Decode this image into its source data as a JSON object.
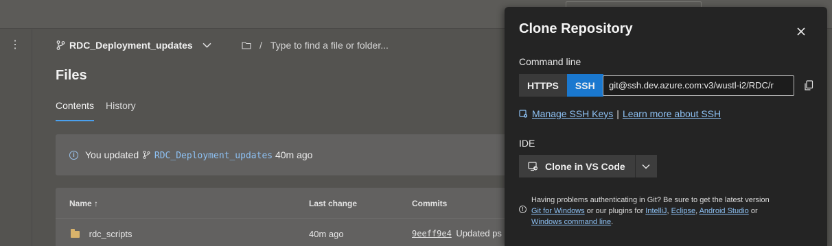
{
  "branch": {
    "name": "RDC_Deployment_updates"
  },
  "path": {
    "separator": "/",
    "placeholder": "Type to find a file or folder..."
  },
  "files_title": "Files",
  "tabs": [
    {
      "label": "Contents",
      "active": true
    },
    {
      "label": "History",
      "active": false
    }
  ],
  "banner": {
    "prefix": "You updated",
    "branch": "RDC_Deployment_updates",
    "suffix": "40m ago"
  },
  "table": {
    "headers": {
      "name": "Name ↑",
      "last_change": "Last change",
      "commits": "Commits"
    },
    "rows": [
      {
        "name": "rdc_scripts",
        "last_change": "40m ago",
        "commit_hash": "9eeff9e4",
        "commit_msg": "Updated ps"
      }
    ]
  },
  "clone_panel": {
    "title": "Clone Repository",
    "command_line_label": "Command line",
    "protocols": [
      {
        "label": "HTTPS",
        "active": false
      },
      {
        "label": "SSH",
        "active": true
      }
    ],
    "url": "git@ssh.dev.azure.com:v3/wustl-i2/RDC/r",
    "manage_keys": "Manage SSH Keys",
    "link_sep": "|",
    "learn_more": "Learn more about SSH",
    "ide_label": "IDE",
    "ide_button": "Clone in VS Code",
    "help": {
      "line1": "Having problems authenticating in Git? Be sure to get the latest version",
      "git_windows": "Git for Windows",
      "mid": " or our plugins for ",
      "intellij": "IntelliJ",
      "comma1": ", ",
      "eclipse": "Eclipse",
      "comma2": ", ",
      "android": "Android Studio",
      "or": " or",
      "cmdline": "Windows command line",
      "period": "."
    }
  },
  "colors": {
    "accent": "#1a78cf",
    "link": "#8ec2f5",
    "panel_bg": "#242424",
    "page_bg": "#545350"
  }
}
